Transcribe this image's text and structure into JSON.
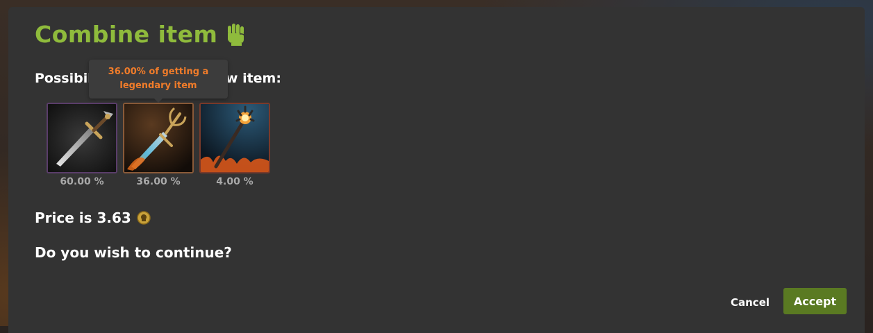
{
  "dialog": {
    "title": "Combine item",
    "title_icon": "fist-icon",
    "subtitle": "Possibilities of getting new item:",
    "tooltip": {
      "line1": "36.00% of getting a",
      "line2": "legendary item"
    },
    "items": [
      {
        "name": "sword",
        "icon": "sword-icon",
        "chance": "60.00 %",
        "rarity_color": "#5a3d6a"
      },
      {
        "name": "trident-blade",
        "icon": "trident-blade-icon",
        "chance": "36.00 %",
        "rarity_color": "#8a5a38"
      },
      {
        "name": "staff",
        "icon": "staff-icon",
        "chance": "4.00 %",
        "rarity_color": "#7a3a2a"
      }
    ],
    "price_label": "Price is 3.63",
    "currency_icon": "coin-icon",
    "question": "Do you wish to continue?",
    "cancel_label": "Cancel",
    "accept_label": "Accept"
  },
  "colors": {
    "title": "#8fbb3c",
    "tooltip_text": "#f07c2a",
    "accept_bg": "#5a7a22",
    "panel_bg": "#333333"
  }
}
